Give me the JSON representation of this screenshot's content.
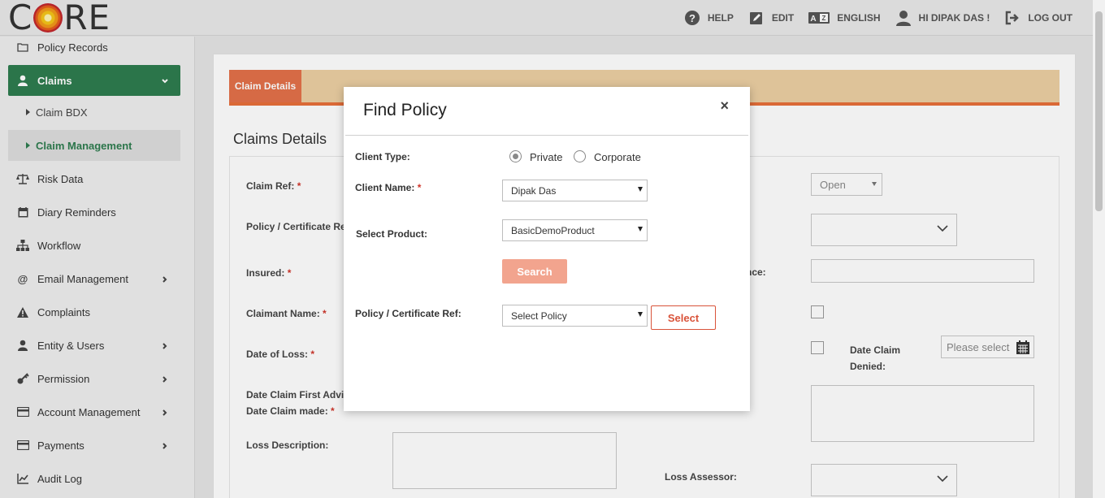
{
  "logo": {
    "text_left": "C",
    "text_right": "RE"
  },
  "topnav": {
    "help": "HELP",
    "edit": "EDIT",
    "language": "ENGLISH",
    "user": "HI DIPAK DAS !",
    "logout": "LOG OUT"
  },
  "sidebar": {
    "policy_records": "Policy Records",
    "claims": "Claims",
    "claim_bdx": "Claim BDX",
    "claim_management": "Claim Management",
    "items": [
      {
        "label": "Risk Data",
        "icon": "balance-scale-icon"
      },
      {
        "label": "Diary Reminders",
        "icon": "calendar-icon"
      },
      {
        "label": "Workflow",
        "icon": "sitemap-icon"
      },
      {
        "label": "Email Management",
        "icon": "at-icon"
      },
      {
        "label": "Complaints",
        "icon": "warning-icon"
      },
      {
        "label": "Entity & Users",
        "icon": "user-icon"
      },
      {
        "label": "Permission",
        "icon": "key-icon"
      },
      {
        "label": "Account Management",
        "icon": "credit-card-icon"
      },
      {
        "label": "Payments",
        "icon": "credit-card-icon"
      },
      {
        "label": "Audit Log",
        "icon": "chart-icon"
      }
    ]
  },
  "tabs": {
    "claim_details": "Claim Details"
  },
  "section_title": "Claims Details",
  "form": {
    "claim_ref": "Claim Ref:",
    "policy_ref": "Policy / Certificate Re",
    "insured": "Insured:",
    "claimant_name": "Claimant Name:",
    "date_of_loss": "Date of Loss:",
    "date_first_advised": "Date Claim First Advi",
    "date_claim_made": "Date Claim made:",
    "loss_description": "Loss Description:",
    "loss_assessor": "Loss Assessor:",
    "status_value": "Open",
    "right_label_partial": "nce:",
    "date_claim_denied": "Date Claim Denied:",
    "date_placeholder": "Please select",
    "required_mark": "*"
  },
  "modal": {
    "title": "Find Policy",
    "close": "×",
    "client_type_label": "Client Type:",
    "radio_private": "Private",
    "radio_corporate": "Corporate",
    "client_type_selected": "Private",
    "client_name_label": "Client Name:",
    "client_name_value": "Dipak Das",
    "select_product_label": "Select Product:",
    "select_product_value": "BasicDemoProduct",
    "search_button": "Search",
    "policy_ref_label": "Policy / Certificate Ref:",
    "policy_ref_value": "Select Policy",
    "select_button": "Select"
  },
  "colors": {
    "brand_green": "#2e7d4f",
    "tab_orange": "#e4714a",
    "tab_bar": "#ecd0a3",
    "search_button": "#f2a48e",
    "select_button_border": "#d9533a"
  }
}
